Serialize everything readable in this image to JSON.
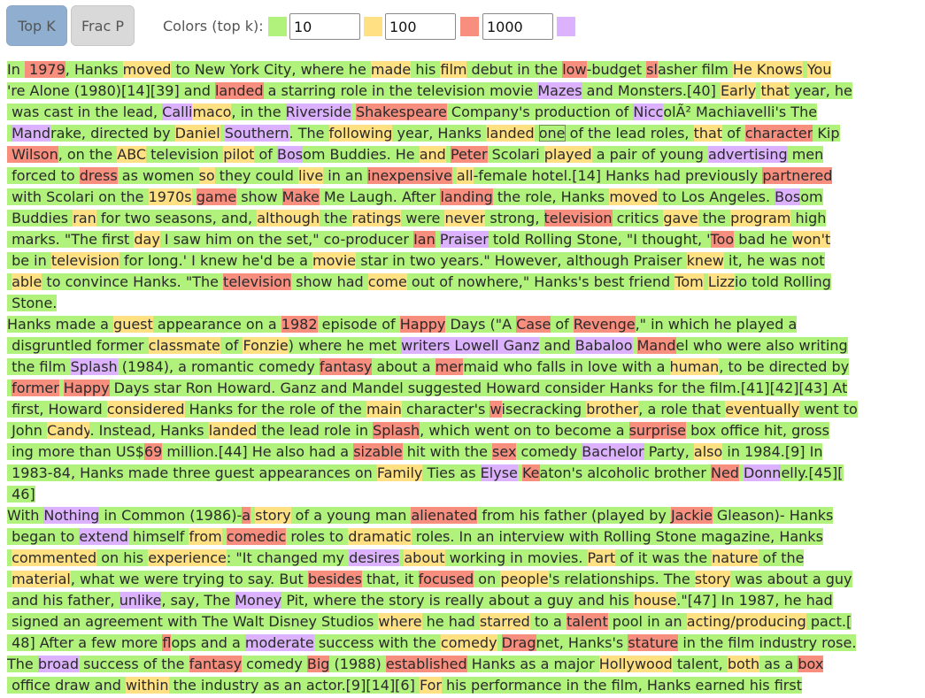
{
  "toolbar": {
    "top_k_label": "Top K",
    "frac_p_label": "Frac P",
    "colors_label": "Colors (top k):",
    "k1": "10",
    "k2": "100",
    "k3": "1000"
  },
  "colors": {
    "rank_top_10": "#b0f27c",
    "rank_top_100": "#ffe083",
    "rank_top_1000": "#f78e7e",
    "rank_beyond": "#dcb2ff"
  },
  "lines": [
    [
      [
        "In ",
        "g"
      ],
      [
        " 1979",
        "r"
      ],
      [
        ", Hanks ",
        "g"
      ],
      [
        "moved",
        "y"
      ],
      [
        " to New York City, where he ",
        "g"
      ],
      [
        "made",
        "y"
      ],
      [
        " his ",
        "g"
      ],
      [
        "film",
        "y"
      ],
      [
        " debut in the ",
        "g"
      ],
      [
        "low",
        "r"
      ],
      [
        "-budget ",
        "g"
      ],
      [
        "sl",
        "r"
      ],
      [
        "asher film ",
        "g"
      ],
      [
        "He Knows",
        "y"
      ],
      [
        " ",
        "g"
      ],
      [
        "You",
        "y"
      ]
    ],
    [
      [
        "'re Alone (1980)[14][39] and ",
        "g"
      ],
      [
        "landed",
        "r"
      ],
      [
        " a starring role in the television movie ",
        "g"
      ],
      [
        "Mazes",
        "p"
      ],
      [
        " and Monsters.[40] ",
        "g"
      ],
      [
        "Early",
        "y"
      ],
      [
        " ",
        "g"
      ],
      [
        "that",
        "y"
      ],
      [
        " year, he",
        "g"
      ]
    ],
    [
      [
        " was cast in the lead, ",
        "g"
      ],
      [
        "Calli",
        "p"
      ],
      [
        "maco",
        "y"
      ],
      [
        ", in the ",
        "g"
      ],
      [
        "Riverside",
        "p"
      ],
      [
        " ",
        "g"
      ],
      [
        "Shakespeare",
        "r"
      ],
      [
        " Company's production of ",
        "g"
      ],
      [
        "Nicc",
        "p"
      ],
      [
        "olÃ² Machiavelli's The",
        "g"
      ]
    ],
    [
      [
        " ",
        "g"
      ],
      [
        "Mand",
        "p"
      ],
      [
        "rake, directed by ",
        "g"
      ],
      [
        "Daniel",
        "y"
      ],
      [
        " ",
        "g"
      ],
      [
        "Southern",
        "p"
      ],
      [
        ". The ",
        "g"
      ],
      [
        "following",
        "y"
      ],
      [
        " year, Hanks ",
        "g"
      ],
      [
        "landed",
        "y"
      ],
      [
        " ",
        "g"
      ],
      [
        "one",
        "box"
      ],
      [
        " of the lead roles, ",
        "g"
      ],
      [
        "that",
        "y"
      ],
      [
        " of ",
        "g"
      ],
      [
        "character",
        "r"
      ],
      [
        " Kip",
        "g"
      ]
    ],
    [
      [
        " Wilson",
        "r"
      ],
      [
        ", on the ",
        "g"
      ],
      [
        "ABC",
        "y"
      ],
      [
        " television ",
        "g"
      ],
      [
        "pilot",
        "y"
      ],
      [
        " of ",
        "g"
      ],
      [
        "Bos",
        "p"
      ],
      [
        "om Buddies. He ",
        "g"
      ],
      [
        "and",
        "y"
      ],
      [
        " ",
        "g"
      ],
      [
        "Peter",
        "r"
      ],
      [
        " Scolari ",
        "g"
      ],
      [
        "played",
        "y"
      ],
      [
        " a pair of young ",
        "g"
      ],
      [
        "advertising",
        "p"
      ],
      [
        " men",
        "g"
      ]
    ],
    [
      [
        " forced to ",
        "g"
      ],
      [
        "dress",
        "r"
      ],
      [
        " as women ",
        "g"
      ],
      [
        "so",
        "y"
      ],
      [
        " they could ",
        "g"
      ],
      [
        "live",
        "y"
      ],
      [
        " in an ",
        "g"
      ],
      [
        "inexpensive",
        "r"
      ],
      [
        " ",
        "g"
      ],
      [
        "all",
        "y"
      ],
      [
        "-female hotel.[14] Hanks had previously ",
        "g"
      ],
      [
        "partnered",
        "r"
      ]
    ],
    [
      [
        " with Scolari on the ",
        "g"
      ],
      [
        "1970s",
        "y"
      ],
      [
        " ",
        "g"
      ],
      [
        "game",
        "r"
      ],
      [
        " show ",
        "g"
      ],
      [
        "Make",
        "r"
      ],
      [
        " Me Laugh. After ",
        "g"
      ],
      [
        "landing",
        "r"
      ],
      [
        " the role, Hanks ",
        "g"
      ],
      [
        "moved",
        "y"
      ],
      [
        " to Los Angeles. ",
        "g"
      ],
      [
        "Bos",
        "p"
      ],
      [
        "om",
        "g"
      ]
    ],
    [
      [
        " Buddies ",
        "g"
      ],
      [
        "ran",
        "y"
      ],
      [
        " for two seasons, and, ",
        "g"
      ],
      [
        "although",
        "y"
      ],
      [
        " the ",
        "g"
      ],
      [
        "ratings",
        "y"
      ],
      [
        " were ",
        "g"
      ],
      [
        "never",
        "y"
      ],
      [
        " strong, ",
        "g"
      ],
      [
        "television",
        "r"
      ],
      [
        " critics ",
        "g"
      ],
      [
        "gave",
        "y"
      ],
      [
        " the ",
        "g"
      ],
      [
        "program",
        "y"
      ],
      [
        " high",
        "g"
      ]
    ],
    [
      [
        " marks. \"The first ",
        "g"
      ],
      [
        "day",
        "y"
      ],
      [
        " I saw him on the set,\" co-producer ",
        "g"
      ],
      [
        "Ian",
        "r"
      ],
      [
        " ",
        "g"
      ],
      [
        "Praiser",
        "p"
      ],
      [
        " told Rolling Stone, \"I thought, '",
        "g"
      ],
      [
        "Too",
        "r"
      ],
      [
        " bad he ",
        "g"
      ],
      [
        "won't",
        "y"
      ]
    ],
    [
      [
        " be in ",
        "g"
      ],
      [
        "television",
        "y"
      ],
      [
        " for long.' I knew he'd be a ",
        "g"
      ],
      [
        "movie",
        "y"
      ],
      [
        " star in two years.\" However, although Praiser ",
        "g"
      ],
      [
        "knew",
        "y"
      ],
      [
        " it, he was not",
        "g"
      ]
    ],
    [
      [
        " ",
        "g"
      ],
      [
        "able",
        "y"
      ],
      [
        " to convince Hanks. \"The ",
        "g"
      ],
      [
        "television",
        "r"
      ],
      [
        " show had ",
        "g"
      ],
      [
        "come",
        "y"
      ],
      [
        " out of nowhere,\" Hanks's best friend ",
        "g"
      ],
      [
        "Tom",
        "y"
      ],
      [
        " ",
        "g"
      ],
      [
        "Lizz",
        "y"
      ],
      [
        "io told Rolling",
        "g"
      ]
    ],
    [
      [
        " Stone.",
        "g"
      ]
    ],
    [
      [
        "Hanks made a ",
        "g"
      ],
      [
        "guest",
        "y"
      ],
      [
        " appearance on a ",
        "g"
      ],
      [
        "1982",
        "r"
      ],
      [
        " episode of ",
        "g"
      ],
      [
        "Happy",
        "r"
      ],
      [
        " Days (\"A ",
        "g"
      ],
      [
        "Case",
        "r"
      ],
      [
        " of ",
        "g"
      ],
      [
        "Revenge",
        "r"
      ],
      [
        ",\" in which he played a",
        "g"
      ]
    ],
    [
      [
        " disgruntled former ",
        "g"
      ],
      [
        "classmate",
        "y"
      ],
      [
        " of ",
        "g"
      ],
      [
        "Fonzie",
        "y"
      ],
      [
        ") where he met ",
        "g"
      ],
      [
        "writers Lowell Ganz",
        "p"
      ],
      [
        " and ",
        "g"
      ],
      [
        "Babaloo",
        "p"
      ],
      [
        " ",
        "g"
      ],
      [
        "Mand",
        "r"
      ],
      [
        "el who were also writing",
        "g"
      ]
    ],
    [
      [
        " the film ",
        "g"
      ],
      [
        "Splash",
        "p"
      ],
      [
        " (1984), a romantic comedy ",
        "g"
      ],
      [
        "fantasy",
        "r"
      ],
      [
        " about a ",
        "g"
      ],
      [
        "mer",
        "r"
      ],
      [
        "maid who falls in love with a ",
        "g"
      ],
      [
        "human",
        "y"
      ],
      [
        ", to be directed by",
        "g"
      ]
    ],
    [
      [
        " ",
        "g"
      ],
      [
        "former",
        "r"
      ],
      [
        " ",
        "g"
      ],
      [
        "Happy",
        "r"
      ],
      [
        " Days star Ron Howard. Ganz and Mandel suggested Howard consider Hanks for the film.[41][42][43] At",
        "g"
      ]
    ],
    [
      [
        " first, Howard ",
        "g"
      ],
      [
        "considered",
        "y"
      ],
      [
        " Hanks for the role of the ",
        "g"
      ],
      [
        "main",
        "y"
      ],
      [
        " character's ",
        "g"
      ],
      [
        "w",
        "r"
      ],
      [
        "isecracking ",
        "g"
      ],
      [
        "brother",
        "y"
      ],
      [
        ", a role that ",
        "g"
      ],
      [
        "eventually",
        "y"
      ],
      [
        " went to",
        "g"
      ]
    ],
    [
      [
        " John ",
        "g"
      ],
      [
        "Candy",
        "y"
      ],
      [
        ". Instead, Hanks ",
        "g"
      ],
      [
        "landed",
        "y"
      ],
      [
        " the lead role in ",
        "g"
      ],
      [
        "Splash",
        "r"
      ],
      [
        ", which went on to become a ",
        "g"
      ],
      [
        "surprise",
        "r"
      ],
      [
        " box office hit, gross",
        "g"
      ]
    ],
    [
      [
        " ing more than US$",
        "g"
      ],
      [
        "69",
        "r"
      ],
      [
        " million.[44] He also had a ",
        "g"
      ],
      [
        "sizable",
        "r"
      ],
      [
        " hit with the ",
        "g"
      ],
      [
        "sex",
        "r"
      ],
      [
        " comedy ",
        "g"
      ],
      [
        "Bachelor",
        "p"
      ],
      [
        " Party, ",
        "g"
      ],
      [
        "also",
        "y"
      ],
      [
        " in 1984.[9] In",
        "g"
      ]
    ],
    [
      [
        " 1983-84, Hanks made three guest appearances on ",
        "g"
      ],
      [
        "Family",
        "y"
      ],
      [
        " Ties as ",
        "g"
      ],
      [
        "Elyse",
        "p"
      ],
      [
        " ",
        "g"
      ],
      [
        "Ke",
        "r"
      ],
      [
        "aton's alcoholic brother ",
        "g"
      ],
      [
        "Ned",
        "r"
      ],
      [
        " ",
        "g"
      ],
      [
        "Donn",
        "p"
      ],
      [
        "elly.[45][",
        "g"
      ]
    ],
    [
      [
        " 46]",
        "g"
      ]
    ],
    [
      [
        "With ",
        "g"
      ],
      [
        "Nothing",
        "p"
      ],
      [
        " in Common (1986)-",
        "g"
      ],
      [
        "a",
        "r"
      ],
      [
        " ",
        "g"
      ],
      [
        "story",
        "y"
      ],
      [
        " of a young man ",
        "g"
      ],
      [
        "alienated",
        "r"
      ],
      [
        " from his father (played by ",
        "g"
      ],
      [
        "Jackie",
        "r"
      ],
      [
        " Gleason)- Hanks",
        "g"
      ]
    ],
    [
      [
        " began to ",
        "g"
      ],
      [
        "extend",
        "p"
      ],
      [
        " himself ",
        "g"
      ],
      [
        "from",
        "y"
      ],
      [
        " ",
        "g"
      ],
      [
        "comedic",
        "r"
      ],
      [
        " roles to ",
        "g"
      ],
      [
        "dramatic",
        "y"
      ],
      [
        " roles. In an interview with Rolling Stone magazine, Hanks",
        "g"
      ]
    ],
    [
      [
        " ",
        "g"
      ],
      [
        "commented",
        "y"
      ],
      [
        " on his ",
        "g"
      ],
      [
        "experience",
        "y"
      ],
      [
        ": \"It changed my ",
        "g"
      ],
      [
        "desires",
        "p"
      ],
      [
        " ",
        "g"
      ],
      [
        "about",
        "y"
      ],
      [
        " working in movies. ",
        "g"
      ],
      [
        "Part",
        "y"
      ],
      [
        " of it was the ",
        "g"
      ],
      [
        "nature",
        "y"
      ],
      [
        " of the",
        "g"
      ]
    ],
    [
      [
        " ",
        "g"
      ],
      [
        "material",
        "y"
      ],
      [
        ", what we were trying to say. But ",
        "g"
      ],
      [
        "besides",
        "r"
      ],
      [
        " that, it ",
        "g"
      ],
      [
        "focused",
        "r"
      ],
      [
        " on ",
        "g"
      ],
      [
        "people",
        "y"
      ],
      [
        "'s relationships. The ",
        "g"
      ],
      [
        "story",
        "y"
      ],
      [
        " was about a guy",
        "g"
      ]
    ],
    [
      [
        " and his father, ",
        "g"
      ],
      [
        "unlike",
        "p"
      ],
      [
        ", say, The ",
        "g"
      ],
      [
        "Money",
        "p"
      ],
      [
        " Pit, where the story is really about a guy and his ",
        "g"
      ],
      [
        "house",
        "y"
      ],
      [
        ".\"[47] In 1987, he had",
        "g"
      ]
    ],
    [
      [
        " signed an agreement with The Walt Disney Studios ",
        "g"
      ],
      [
        "where",
        "y"
      ],
      [
        " he had ",
        "g"
      ],
      [
        "starred",
        "y"
      ],
      [
        " to a ",
        "g"
      ],
      [
        "talent",
        "r"
      ],
      [
        " pool in an ",
        "g"
      ],
      [
        "acting/producing",
        "y"
      ],
      [
        " pact.[",
        "g"
      ]
    ],
    [
      [
        " 48] After a few more ",
        "g"
      ],
      [
        "fl",
        "r"
      ],
      [
        "ops and a ",
        "g"
      ],
      [
        "moderate",
        "p"
      ],
      [
        " success with the ",
        "g"
      ],
      [
        "comedy",
        "y"
      ],
      [
        " ",
        "g"
      ],
      [
        "Drag",
        "r"
      ],
      [
        "net, Hanks's ",
        "g"
      ],
      [
        "stature",
        "r"
      ],
      [
        " in the film industry rose.",
        "g"
      ]
    ],
    [
      [
        "The ",
        "g"
      ],
      [
        "broad",
        "p"
      ],
      [
        " success of the ",
        "g"
      ],
      [
        "fantasy",
        "r"
      ],
      [
        " comedy ",
        "g"
      ],
      [
        "Big",
        "r"
      ],
      [
        " (1988) ",
        "g"
      ],
      [
        "established",
        "r"
      ],
      [
        " Hanks as a major ",
        "g"
      ],
      [
        "Hollywood",
        "y"
      ],
      [
        " talent, ",
        "g"
      ],
      [
        "both",
        "y"
      ],
      [
        " as a ",
        "g"
      ],
      [
        "box",
        "r"
      ]
    ],
    [
      [
        " office draw and ",
        "g"
      ],
      [
        "within",
        "y"
      ],
      [
        " the industry as an actor.[9][14][6] ",
        "g"
      ],
      [
        "For",
        "y"
      ],
      [
        " his performance in the film, Hanks earned his first",
        "g"
      ]
    ]
  ]
}
